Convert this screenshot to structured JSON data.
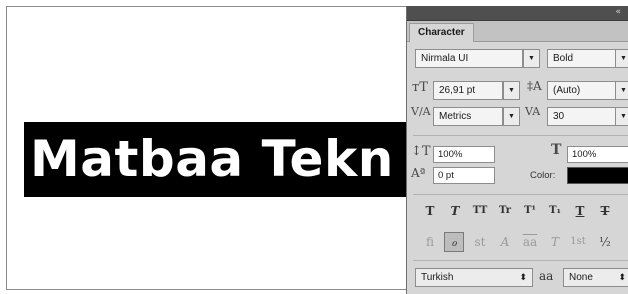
{
  "document": {
    "text": "Matbaa Tekn"
  },
  "panel": {
    "tab_label": "Character",
    "collapse_icon": "«",
    "font_family": "Nirmala UI",
    "font_style": "Bold",
    "font_size": "26,91 pt",
    "leading": "(Auto)",
    "kerning": "Metrics",
    "tracking": "30",
    "vertical_scale": "100%",
    "horizontal_scale": "100%",
    "baseline_shift": "0 pt",
    "color_label": "Color:",
    "color_value": "#000000",
    "language": "Turkish",
    "antialias": "None",
    "aa_glyph": "aa",
    "dropdown_arrow": "▼",
    "language_arrow": "⬍",
    "style_buttons": [
      "T",
      "T",
      "TT",
      "Tr",
      "T¹",
      "T₁",
      "T",
      "T"
    ],
    "opentype_buttons": [
      "fi",
      "ℴ",
      "st",
      "A",
      "aa",
      "T",
      "1st",
      "½"
    ]
  }
}
